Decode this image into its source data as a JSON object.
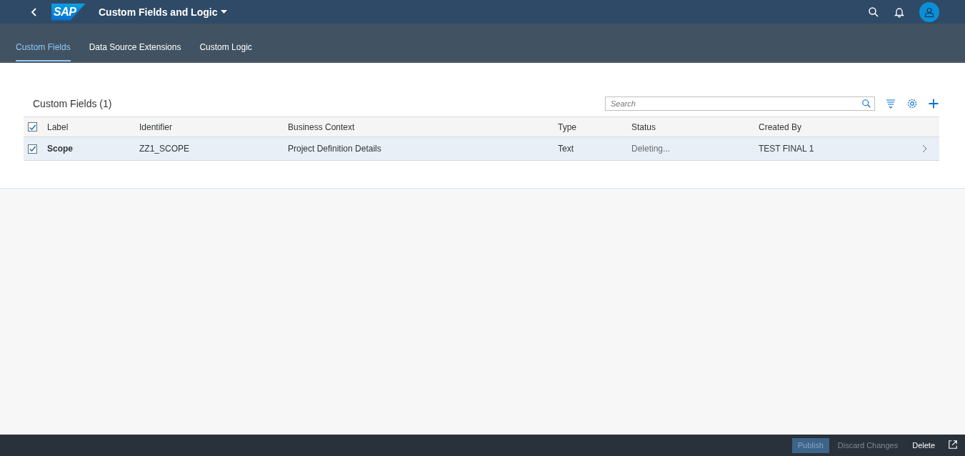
{
  "shell": {
    "logo": "SAP",
    "title": "Custom Fields and Logic"
  },
  "tabs": [
    {
      "label": "Custom Fields",
      "selected": true
    },
    {
      "label": "Data Source Extensions",
      "selected": false
    },
    {
      "label": "Custom Logic",
      "selected": false
    }
  ],
  "table": {
    "title": "Custom Fields (1)",
    "search": {
      "placeholder": "Search"
    },
    "select_all_checked": true,
    "columns": [
      "Label",
      "Identifier",
      "Business Context",
      "Type",
      "Status",
      "Created By"
    ],
    "rows": [
      {
        "selected": true,
        "checked": true,
        "cells": [
          "Scope",
          "ZZ1_SCOPE",
          "Project Definition Details",
          "Text",
          "Deleting...",
          "TEST FINAL 1"
        ]
      }
    ]
  },
  "footer": {
    "buttons": [
      {
        "label": "Publish",
        "kind": "emphasized",
        "disabled": true
      },
      {
        "label": "Discard Changes",
        "kind": "transparent",
        "disabled": true
      },
      {
        "label": "Delete",
        "kind": "transparent",
        "disabled": false
      }
    ]
  }
}
